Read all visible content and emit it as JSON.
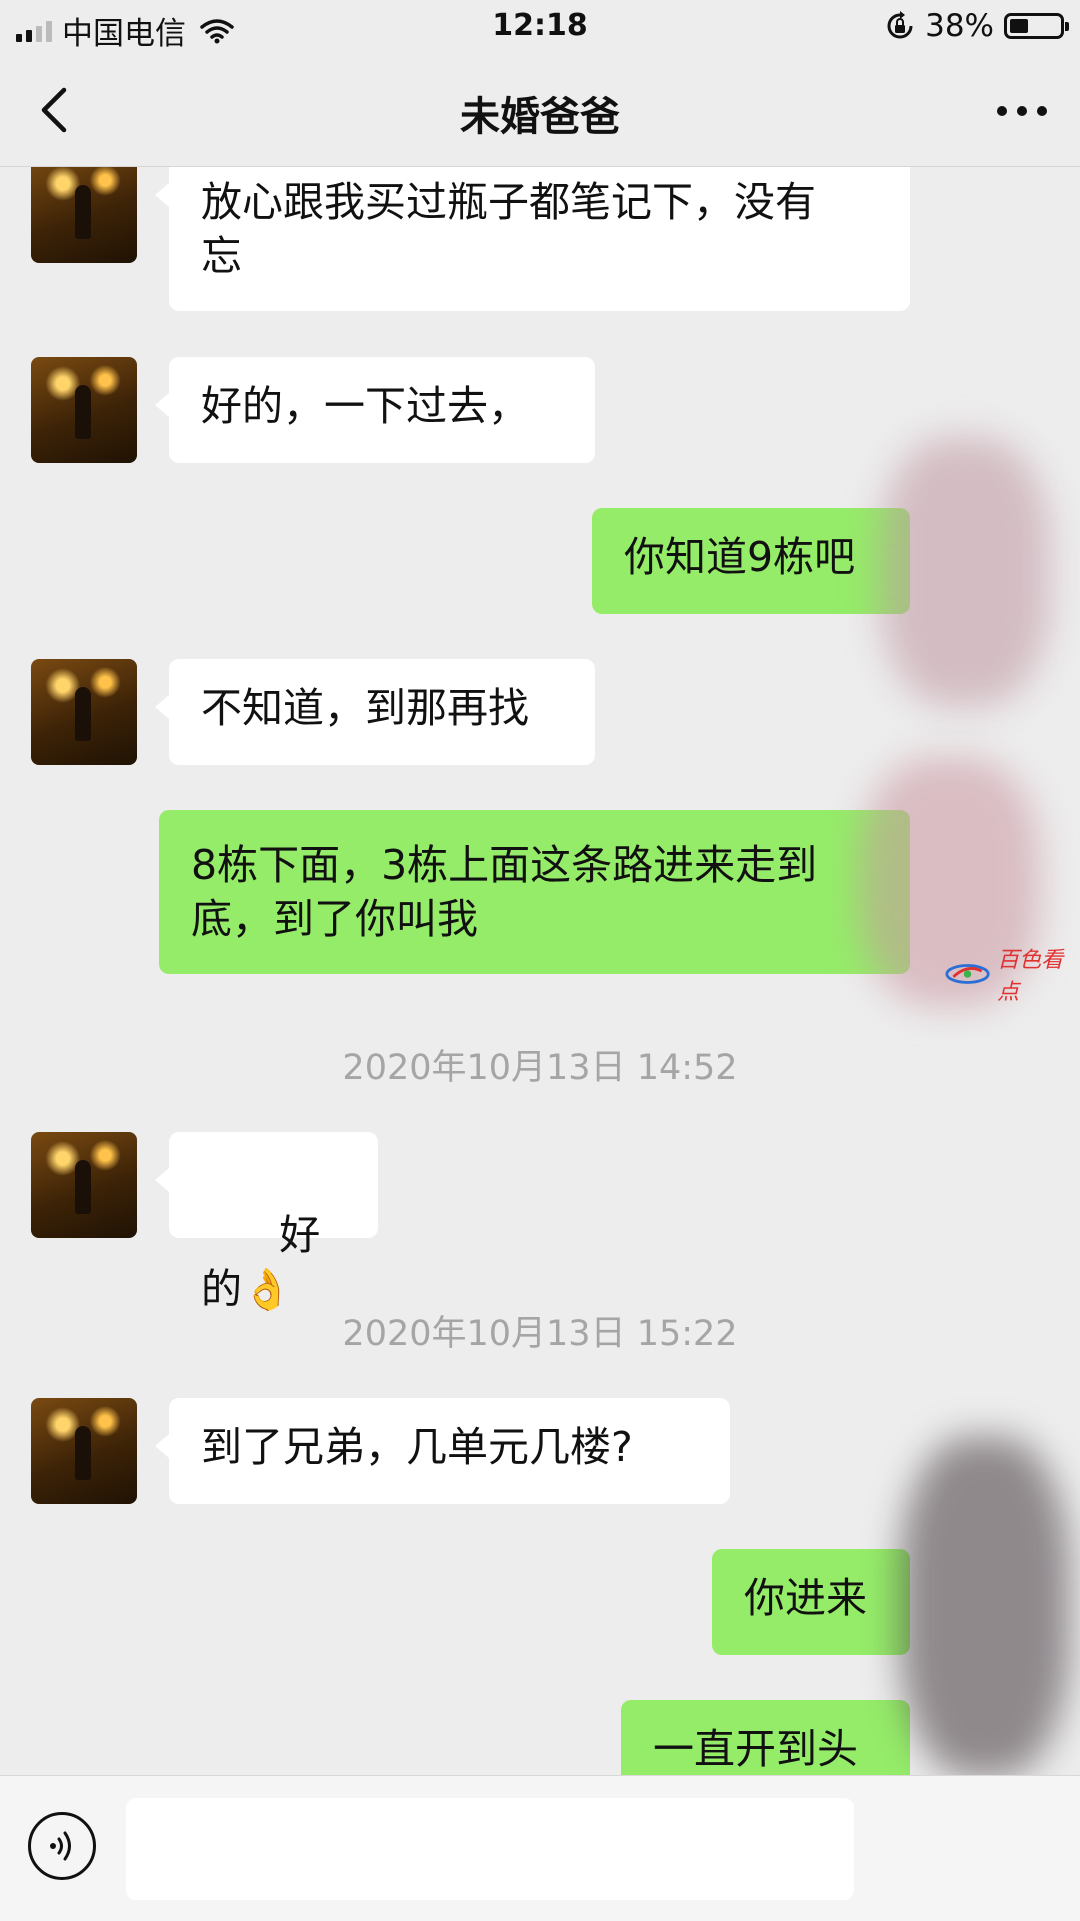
{
  "status_bar": {
    "carrier": "中国电信",
    "time": "12:18",
    "battery_percent": "38%",
    "battery_level": 0.38,
    "signal_bars": 2
  },
  "nav": {
    "title": "未婚爸爸",
    "back_icon": "chevron-left-icon",
    "more_icon": "more-dots-icon"
  },
  "messages": [
    {
      "type": "in",
      "text": "放心跟我买过瓶子都笔记下，没有\n忘"
    },
    {
      "type": "in",
      "text": "好的，一下过去，"
    },
    {
      "type": "out",
      "text": "你知道9栋吧"
    },
    {
      "type": "in",
      "text": "不知道，到那再找"
    },
    {
      "type": "out",
      "text": "8栋下面，3栋上面这条路进来走到\n底，到了你叫我"
    },
    {
      "type": "time",
      "text": "2020年10月13日 14:52"
    },
    {
      "type": "in",
      "text": "好的",
      "emoji": "👌"
    },
    {
      "type": "time",
      "text": "2020年10月13日 15:22"
    },
    {
      "type": "in",
      "text": "到了兄弟，几单元几楼?"
    },
    {
      "type": "out",
      "text": "你进来"
    },
    {
      "type": "out",
      "text": "一直开到头"
    }
  ],
  "watermark": {
    "text": "百色看点"
  },
  "input_bar": {
    "placeholder": "",
    "voice_icon": "voice-icon"
  },
  "colors": {
    "background": "#ededed",
    "incoming_bubble": "#ffffff",
    "outgoing_bubble": "#95ec69",
    "timestamp": "#a5a5a5"
  }
}
